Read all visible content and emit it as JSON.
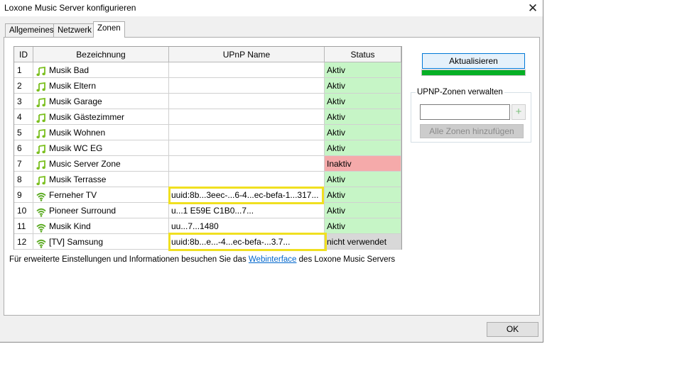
{
  "window": {
    "title": "Loxone Music Server konfigurieren",
    "close_glyph": "✕"
  },
  "tabs": [
    {
      "label": "Allgemeines",
      "active": false
    },
    {
      "label": "Netzwerk",
      "active": false
    },
    {
      "label": "Zonen",
      "active": true
    }
  ],
  "table": {
    "headers": {
      "id": "ID",
      "name": "Bezeichnung",
      "upnp": "UPnP Name",
      "status": "Status"
    },
    "rows": [
      {
        "id": "1",
        "icon": "music-note-icon",
        "name": "Musik Bad",
        "upnp": "",
        "status": "Aktiv",
        "state": "active"
      },
      {
        "id": "2",
        "icon": "music-note-icon",
        "name": "Musik Eltern",
        "upnp": "",
        "status": "Aktiv",
        "state": "active"
      },
      {
        "id": "3",
        "icon": "music-note-icon",
        "name": "Musik Garage",
        "upnp": "",
        "status": "Aktiv",
        "state": "active"
      },
      {
        "id": "4",
        "icon": "music-note-icon",
        "name": "Musik Gästezimmer",
        "upnp": "",
        "status": "Aktiv",
        "state": "active"
      },
      {
        "id": "5",
        "icon": "music-note-icon",
        "name": "Musik Wohnen",
        "upnp": "",
        "status": "Aktiv",
        "state": "active"
      },
      {
        "id": "6",
        "icon": "music-note-icon",
        "name": "Musik WC EG",
        "upnp": "",
        "status": "Aktiv",
        "state": "active"
      },
      {
        "id": "7",
        "icon": "music-note-icon",
        "name": "Music Server Zone",
        "upnp": "",
        "status": "Inaktiv",
        "state": "inactive"
      },
      {
        "id": "8",
        "icon": "music-note-icon",
        "name": "Musik Terrasse",
        "upnp": "",
        "status": "Aktiv",
        "state": "active"
      },
      {
        "id": "9",
        "icon": "wifi-icon",
        "name": "Ferneher TV",
        "upnp": "uuid:8b...3eec-...6-4...ec-befa-1...317...",
        "status": "Aktiv",
        "state": "active"
      },
      {
        "id": "10",
        "icon": "wifi-icon",
        "name": "Pioneer Surround",
        "upnp": "u...1 E59E C1B0...7...",
        "status": "Aktiv",
        "state": "active"
      },
      {
        "id": "11",
        "icon": "wifi-icon",
        "name": "Musik Kind",
        "upnp": "uu...7...1480",
        "status": "Aktiv",
        "state": "active"
      },
      {
        "id": "12",
        "icon": "wifi-icon",
        "name": "[TV] Samsung",
        "upnp": "uuid:8b...e...-4...ec-befa-...3.7...",
        "status": "nicht verwendet",
        "state": "unused"
      }
    ]
  },
  "sidebar": {
    "refresh_label": "Aktualisieren",
    "progress": 1.0,
    "group_label": "UPNP-Zonen verwalten",
    "zone_input_value": "",
    "add_zone_label": "+",
    "add_all_label": "Alle Zonen hinzufügen"
  },
  "info": {
    "prefix": "Für erweiterte Einstellungen und Informationen besuchen Sie das ",
    "link": "Webinterface",
    "suffix": " des Loxone Music Servers"
  },
  "footer": {
    "ok_label": "OK"
  },
  "colors": {
    "active": "#c6f5c6",
    "inactive": "#f5aaaa",
    "unused": "#d8d8d8",
    "highlight": "#f0e020",
    "progress": "#06b025",
    "music_icon": "#7bbf1f",
    "wifi_icon": "#5aaa20"
  }
}
